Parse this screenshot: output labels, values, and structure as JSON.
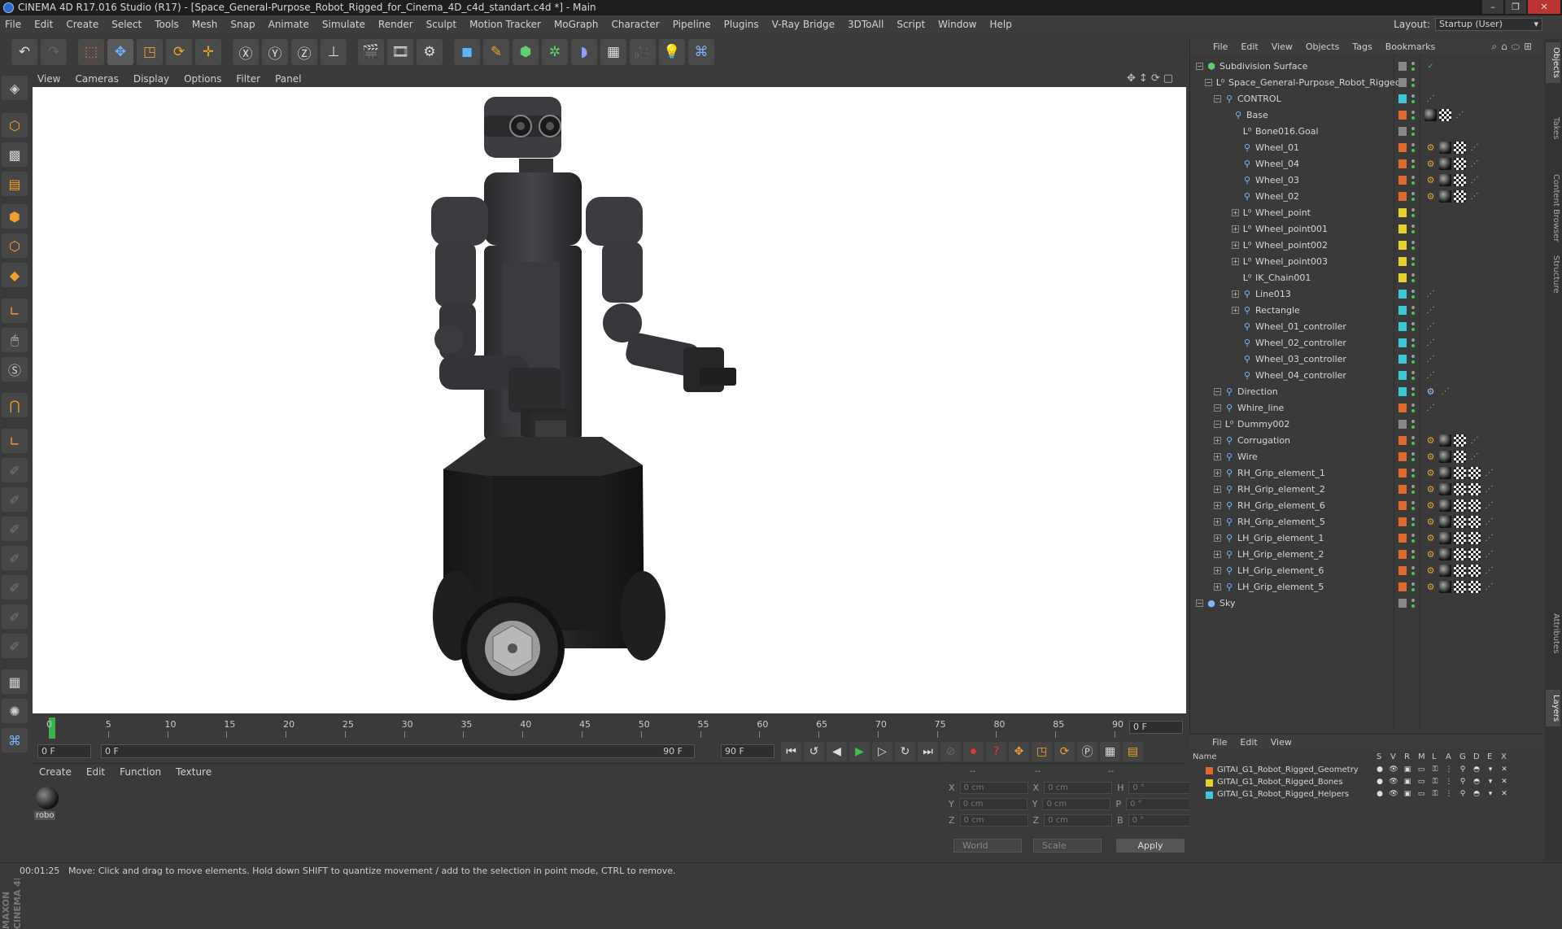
{
  "window": {
    "title": "CINEMA 4D R17.016 Studio (R17) - [Space_General-Purpose_Robot_Rigged_for_Cinema_4D_c4d_standart.c4d *] - Main"
  },
  "menu": [
    "File",
    "Edit",
    "Create",
    "Select",
    "Tools",
    "Mesh",
    "Snap",
    "Animate",
    "Simulate",
    "Render",
    "Sculpt",
    "Motion Tracker",
    "MoGraph",
    "Character",
    "Pipeline",
    "Plugins",
    "V-Ray Bridge",
    "3DToAll",
    "Script",
    "Window",
    "Help"
  ],
  "layout": {
    "label": "Layout:",
    "value": "Startup (User)"
  },
  "viewport_menu": [
    "View",
    "Cameras",
    "Display",
    "Options",
    "Filter",
    "Panel"
  ],
  "timeline": {
    "ticks": [
      "0",
      "5",
      "10",
      "15",
      "20",
      "25",
      "30",
      "35",
      "40",
      "45",
      "50",
      "55",
      "60",
      "65",
      "70",
      "75",
      "80",
      "85",
      "90"
    ],
    "frame_display": "0 F",
    "current_frame": "0 F",
    "range_start": "0 F",
    "range_end": "90 F",
    "max_frame": "90 F",
    "range_end_right": "90 F"
  },
  "material_manager": {
    "menu": [
      "Create",
      "Edit",
      "Function",
      "Texture"
    ],
    "materials": [
      {
        "name": "robo"
      }
    ]
  },
  "attributes": {
    "headers": [
      "--",
      "--",
      "--"
    ],
    "rows": [
      {
        "a_label": "X",
        "a_value": "0 cm",
        "b_label": "X",
        "b_value": "0 cm",
        "c_label": "H",
        "c_value": "0 °"
      },
      {
        "a_label": "Y",
        "a_value": "0 cm",
        "b_label": "Y",
        "b_value": "0 cm",
        "c_label": "P",
        "c_value": "0 °"
      },
      {
        "a_label": "Z",
        "a_value": "0 cm",
        "b_label": "Z",
        "b_value": "0 cm",
        "c_label": "B",
        "c_value": "0 °"
      }
    ],
    "coord_mode": "World",
    "size_mode": "Scale",
    "apply_label": "Apply"
  },
  "status": {
    "time": "00:01:25",
    "message": "Move: Click and drag to move elements. Hold down SHIFT to quantize movement / add to the selection in point mode, CTRL to remove."
  },
  "object_manager": {
    "menu": [
      "File",
      "Edit",
      "View",
      "Objects",
      "Tags",
      "Bookmarks"
    ],
    "objects": [
      {
        "name": "Subdivision Surface",
        "level": 0,
        "icon": "subdivision-icon",
        "color": "#888888",
        "tags": "check"
      },
      {
        "name": "Space_General-Purpose_Robot_Rigged",
        "level": 1,
        "icon": "null-icon",
        "color": "#888888",
        "tags": ""
      },
      {
        "name": "CONTROL",
        "level": 2,
        "icon": "bone-icon",
        "color": "#3ec7d6",
        "tags": "set"
      },
      {
        "name": "Base",
        "level": 3,
        "icon": "bone-icon",
        "color": "#e06a2b",
        "tags": "mat-chk-set"
      },
      {
        "name": "Bone016.Goal",
        "level": 4,
        "icon": "null-icon",
        "color": "#888888",
        "tags": ""
      },
      {
        "name": "Wheel_01",
        "level": 4,
        "icon": "bone-icon",
        "color": "#e06a2b",
        "tags": "ik-mat-chk-set"
      },
      {
        "name": "Wheel_04",
        "level": 4,
        "icon": "bone-icon",
        "color": "#e06a2b",
        "tags": "ik-mat-chk-set"
      },
      {
        "name": "Wheel_03",
        "level": 4,
        "icon": "bone-icon",
        "color": "#e06a2b",
        "tags": "ik-mat-chk-set"
      },
      {
        "name": "Wheel_02",
        "level": 4,
        "icon": "bone-icon",
        "color": "#e06a2b",
        "tags": "ik-mat-chk-set"
      },
      {
        "name": "Wheel_point",
        "level": 4,
        "icon": "null-icon",
        "color": "#e6d22c",
        "tags": "",
        "expand": true
      },
      {
        "name": "Wheel_point001",
        "level": 4,
        "icon": "null-icon",
        "color": "#e6d22c",
        "tags": "",
        "expand": true
      },
      {
        "name": "Wheel_point002",
        "level": 4,
        "icon": "null-icon",
        "color": "#e6d22c",
        "tags": "",
        "expand": true
      },
      {
        "name": "Wheel_point003",
        "level": 4,
        "icon": "null-icon",
        "color": "#e6d22c",
        "tags": "",
        "expand": true
      },
      {
        "name": "IK_Chain001",
        "level": 4,
        "icon": "null-icon",
        "color": "#e6d22c",
        "tags": ""
      },
      {
        "name": "Line013",
        "level": 4,
        "icon": "bone-icon",
        "color": "#3ec7d6",
        "tags": "set",
        "expand": true
      },
      {
        "name": "Rectangle",
        "level": 4,
        "icon": "bone-icon",
        "color": "#3ec7d6",
        "tags": "set",
        "expand": true
      },
      {
        "name": "Wheel_01_controller",
        "level": 4,
        "icon": "bone-icon",
        "color": "#3ec7d6",
        "tags": "set"
      },
      {
        "name": "Wheel_02_controller",
        "level": 4,
        "icon": "bone-icon",
        "color": "#3ec7d6",
        "tags": "set"
      },
      {
        "name": "Wheel_03_controller",
        "level": 4,
        "icon": "bone-icon",
        "color": "#3ec7d6",
        "tags": "set"
      },
      {
        "name": "Wheel_04_controller",
        "level": 4,
        "icon": "bone-icon",
        "color": "#3ec7d6",
        "tags": "set"
      },
      {
        "name": "Direction",
        "level": 2,
        "icon": "bone-icon",
        "color": "#3ec7d6",
        "tags": "wire-set"
      },
      {
        "name": "Whire_line",
        "level": 2,
        "icon": "bone-icon",
        "color": "#e06a2b",
        "tags": "set"
      },
      {
        "name": "Dummy002",
        "level": 2,
        "icon": "null-icon",
        "color": "#888888",
        "tags": ""
      },
      {
        "name": "Corrugation",
        "level": 2,
        "icon": "bone-icon",
        "color": "#e06a2b",
        "tags": "ik-mat-chk-set",
        "expand": true
      },
      {
        "name": "Wire",
        "level": 2,
        "icon": "bone-icon",
        "color": "#e06a2b",
        "tags": "ik-mat-chk-set",
        "expand": true
      },
      {
        "name": "RH_Grip_element_1",
        "level": 2,
        "icon": "bone-icon",
        "color": "#e06a2b",
        "tags": "ik-mat-chk-chk-set",
        "expand": true
      },
      {
        "name": "RH_Grip_element_2",
        "level": 2,
        "icon": "bone-icon",
        "color": "#e06a2b",
        "tags": "ik-mat-chk-chk-set",
        "expand": true
      },
      {
        "name": "RH_Grip_element_6",
        "level": 2,
        "icon": "bone-icon",
        "color": "#e06a2b",
        "tags": "ik-mat-chk-chk-set",
        "expand": true
      },
      {
        "name": "RH_Grip_element_5",
        "level": 2,
        "icon": "bone-icon",
        "color": "#e06a2b",
        "tags": "ik-mat-chk-chk-set",
        "expand": true
      },
      {
        "name": "LH_Grip_element_1",
        "level": 2,
        "icon": "bone-icon",
        "color": "#e06a2b",
        "tags": "ik-mat-chk-chk-set",
        "expand": true
      },
      {
        "name": "LH_Grip_element_2",
        "level": 2,
        "icon": "bone-icon",
        "color": "#e06a2b",
        "tags": "ik-mat-chk-chk-set",
        "expand": true
      },
      {
        "name": "LH_Grip_element_6",
        "level": 2,
        "icon": "bone-icon",
        "color": "#e06a2b",
        "tags": "ik-mat-chk-chk-set",
        "expand": true
      },
      {
        "name": "LH_Grip_element_5",
        "level": 2,
        "icon": "bone-icon",
        "color": "#e06a2b",
        "tags": "ik-mat-chk-chk-set",
        "expand": true
      },
      {
        "name": "Sky",
        "level": 0,
        "icon": "sky-icon",
        "color": "#888888",
        "tags": ""
      }
    ]
  },
  "layer_manager": {
    "menu": [
      "File",
      "Edit",
      "View"
    ],
    "columns": [
      "Name",
      "S",
      "V",
      "R",
      "M",
      "L",
      "A",
      "G",
      "D",
      "E",
      "X"
    ],
    "layers": [
      {
        "name": "GITAI_G1_Robot_Rigged_Geometry",
        "color": "#e06a2b"
      },
      {
        "name": "GITAI_G1_Robot_Rigged_Bones",
        "color": "#e6d22c"
      },
      {
        "name": "GITAI_G1_Robot_Rigged_Helpers",
        "color": "#3ec7d6"
      }
    ]
  },
  "side_tabs": [
    "Objects",
    "Takes",
    "Content Browser",
    "Structure",
    "Attributes",
    "Layers"
  ],
  "branding": "MAXON CINEMA 4D"
}
